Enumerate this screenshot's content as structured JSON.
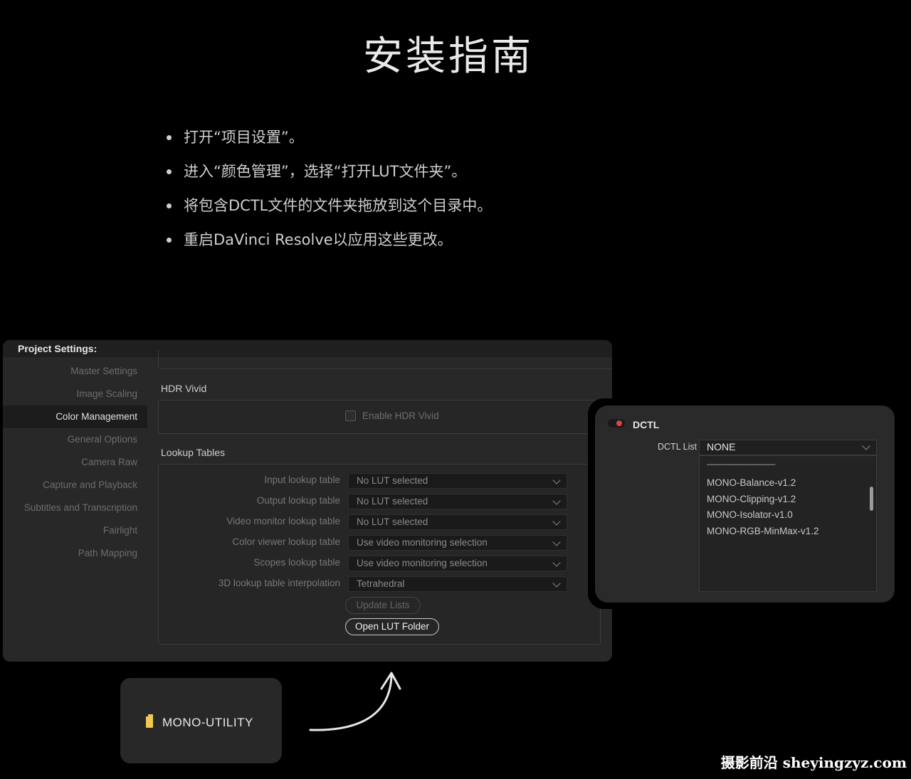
{
  "page": {
    "title": "安装指南",
    "steps": [
      "打开“项目设置”。",
      "进入“颜色管理”，选择“打开LUT文件夹”。",
      "将包含DCTL文件的文件夹拖放到这个目录中。",
      "重启DaVinci Resolve以应用这些更改。"
    ]
  },
  "project_settings": {
    "title": "Project Settings:",
    "nav": [
      "Master Settings",
      "Image Scaling",
      "Color Management",
      "General Options",
      "Camera Raw",
      "Capture and Playback",
      "Subtitles and Transcription",
      "Fairlight",
      "Path Mapping"
    ],
    "active_nav": "Color Management",
    "hdr_section": "HDR Vivid",
    "hdr_checkbox": "Enable HDR Vivid",
    "lut_section": "Lookup Tables",
    "lut_rows": [
      {
        "label": "Input lookup table",
        "value": "No LUT selected"
      },
      {
        "label": "Output lookup table",
        "value": "No LUT selected"
      },
      {
        "label": "Video monitor lookup table",
        "value": "No LUT selected"
      },
      {
        "label": "Color viewer lookup table",
        "value": "Use video monitoring selection"
      },
      {
        "label": "Scopes lookup table",
        "value": "Use video monitoring selection"
      },
      {
        "label": "3D lookup table interpolation",
        "value": "Tetrahedral"
      }
    ],
    "update_button": "Update Lists",
    "open_folder_button": "Open LUT Folder"
  },
  "dctl": {
    "title": "DCTL",
    "list_label": "DCTL List",
    "selected": "NONE",
    "divider": "------------------------------------",
    "items": [
      "MONO-Balance-v1.2",
      "MONO-Clipping-v1.2",
      "MONO-Isolator-v1.0",
      "MONO-RGB-MinMax-v1.2"
    ],
    "toggle_color": "#e2453b"
  },
  "folder": {
    "name": "MONO-UTILITY",
    "icon": "folder-icon",
    "icon_color": "#f2c94c"
  },
  "watermark": "摄影前沿 sheyingzyz.com"
}
